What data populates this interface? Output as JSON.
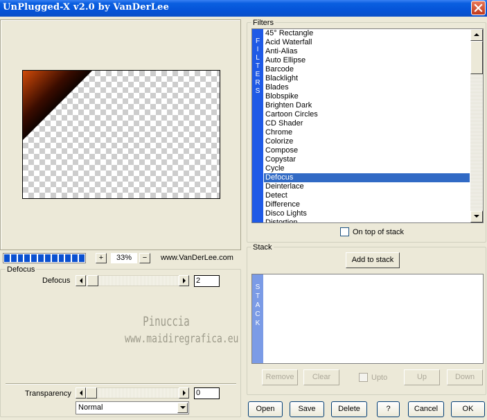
{
  "window": {
    "title": "UnPlugged-X v2.0 by VanDerLee"
  },
  "icons": {
    "close": "close-icon",
    "zoom_in": "plus-icon",
    "zoom_out": "minus-icon"
  },
  "colors": {
    "accent": "#316ac5",
    "strip": "#1f5ae6",
    "stack_strip": "#7b9be6",
    "progress": "#0a50d0"
  },
  "preview": {
    "zoom_plus": "+",
    "zoom_minus": "−",
    "zoom_value": "33%",
    "website": "www.VanDerLee.com",
    "progress_fraction": 1.0
  },
  "params": {
    "group_label": "Defocus",
    "defocus_label": "Defocus",
    "defocus_value": "2",
    "watermark_line1": "Pinuccia",
    "watermark_line2": "www.maidiregrafica.eu",
    "transparency_label": "Transparency",
    "transparency_value": "0",
    "blend_mode": "Normal"
  },
  "filters": {
    "group_label": "Filters",
    "strip_letters": [
      "F",
      "I",
      "L",
      "T",
      "E",
      "R",
      "S"
    ],
    "items": [
      "45° Rectangle",
      "Acid Waterfall",
      "Anti-Alias",
      "Auto Ellipse",
      "Barcode",
      "Blacklight",
      "Blades",
      "Blobspike",
      "Brighten Dark",
      "Cartoon Circles",
      "CD Shader",
      "Chrome",
      "Colorize",
      "Compose",
      "Copystar",
      "Cycle",
      "Defocus",
      "Deinterlace",
      "Detect",
      "Difference",
      "Disco Lights",
      "Distortion"
    ],
    "selected": "Defocus",
    "on_top_label": "On top of stack"
  },
  "stack": {
    "group_label": "Stack",
    "add_button": "Add to stack",
    "strip_letters": [
      "S",
      "T",
      "A",
      "C",
      "K"
    ],
    "remove": "Remove",
    "clear": "Clear",
    "upto": "Upto",
    "up": "Up",
    "down": "Down"
  },
  "footer": {
    "open": "Open",
    "save": "Save",
    "delete": "Delete",
    "help": "?",
    "cancel": "Cancel",
    "ok": "OK"
  }
}
